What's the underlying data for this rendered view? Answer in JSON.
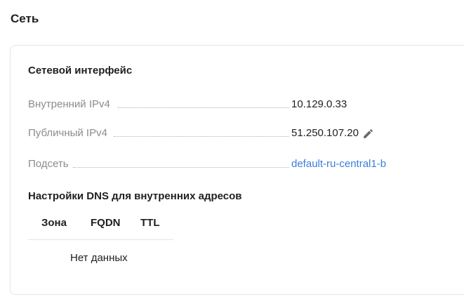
{
  "section": {
    "title": "Сеть"
  },
  "network_interface": {
    "title": "Сетевой интерфейс",
    "properties": [
      {
        "label": "Внутренний IPv4",
        "value": "10.129.0.33"
      },
      {
        "label": "Публичный IPv4",
        "value": "51.250.107.20",
        "icon": "pencil-edit-icon"
      },
      {
        "label": "Подсеть",
        "value": "default-ru-central1-b",
        "is_link": true
      }
    ]
  },
  "dns_settings": {
    "title": "Настройки DNS для внутренних адресов",
    "columns": [
      "Зона",
      "FQDN",
      "TTL"
    ],
    "empty_text": "Нет данных"
  },
  "colors": {
    "label": "#8c8c8c",
    "text": "#1f1f1f",
    "link": "#3b7ddd",
    "border": "#e5e5e5"
  }
}
